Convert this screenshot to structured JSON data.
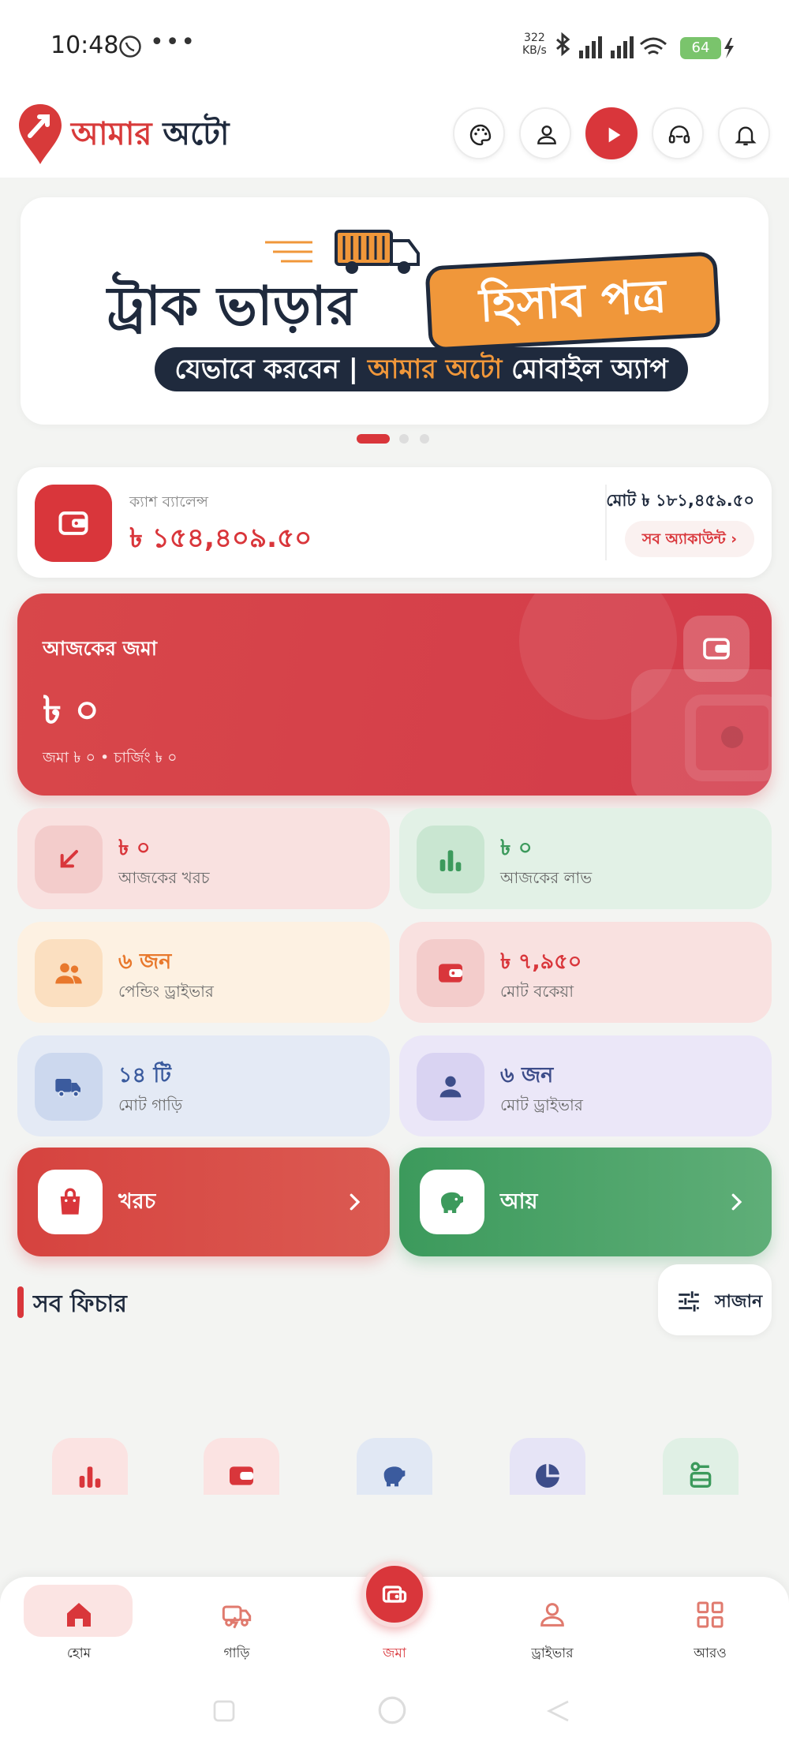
{
  "status_bar": {
    "time": "10:48",
    "net_speed_value": "322",
    "net_speed_unit": "KB/s",
    "battery": "64"
  },
  "header": {
    "logo_text_a": "আমার",
    "logo_text_b": "অটো",
    "icons": [
      "palette-icon",
      "user-icon",
      "play-icon",
      "support-icon",
      "bell-icon"
    ]
  },
  "banner": {
    "title": "ট্রাক ভাড়ার",
    "badge": "হিসাব পত্র",
    "subtitle_a": "যেভাবে করবেন |",
    "subtitle_b": "আমার অটো",
    "subtitle_c": "মোবাইল অ্যাপ"
  },
  "cash": {
    "label": "ক্যাশ ব্যালেন্স",
    "amount": "৳ ১৫৪,৪০৯.৫০",
    "total": "মোট ৳ ১৮১,৪৫৯.৫০",
    "all_accounts": "সব অ্যাকাউন্ট"
  },
  "today_deposit": {
    "label": "আজকের জমা",
    "amount": "৳ ০",
    "sub": "জমা ৳ ০  •  চার্জিং ৳ ০"
  },
  "stats": [
    {
      "value": "৳ ০",
      "label": "আজকের খরচ",
      "icon": "arrow-down-left-icon",
      "color": "#d9363b"
    },
    {
      "value": "৳ ০",
      "label": "আজকের লাভ",
      "icon": "bar-chart-icon",
      "color": "#3c9a5c"
    },
    {
      "value": "৬ জন",
      "label": "পেন্ডিং ড্রাইভার",
      "icon": "users-icon",
      "color": "#e8782c"
    },
    {
      "value": "৳ ৭,৯৫০",
      "label": "মোট বকেয়া",
      "icon": "wallet-icon",
      "color": "#d9363b"
    },
    {
      "value": "১৪ টি",
      "label": "মোট গাড়ি",
      "icon": "truck-icon",
      "color": "#3b5b9e"
    },
    {
      "value": "৬ জন",
      "label": "মোট ড্রাইভার",
      "icon": "person-icon",
      "color": "#3d4d8a"
    }
  ],
  "actions": {
    "expense": {
      "label": "খরচ",
      "color": "#d9363b"
    },
    "income": {
      "label": "আয়",
      "color": "#3c9a5c"
    }
  },
  "features": {
    "title": "সব ফিচার",
    "arrange_label": "সাজান",
    "icons": [
      "bar-chart-icon",
      "wallet-icon",
      "piggy-bank-icon",
      "pie-chart-icon",
      "car-icon"
    ]
  },
  "bottom_nav": {
    "items": [
      {
        "label": "হোম",
        "icon": "home-icon"
      },
      {
        "label": "গাড়ি",
        "icon": "vehicle-icon"
      },
      {
        "label": "জমা",
        "icon": "deposit-icon"
      },
      {
        "label": "ড্রাইভার",
        "icon": "driver-icon"
      },
      {
        "label": "আরও",
        "icon": "grid-icon"
      }
    ]
  }
}
